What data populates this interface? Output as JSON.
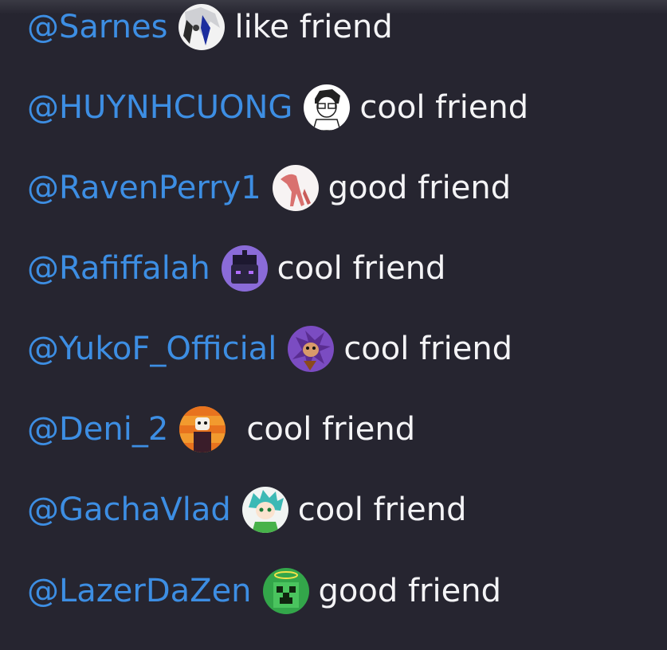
{
  "friends": [
    {
      "mention": "@Sarnes",
      "avatar_icon": "anime-avatar-white-hair-icon",
      "label": "like friend"
    },
    {
      "mention": "@HUYNHCUONG",
      "avatar_icon": "sketch-boy-avatar-icon",
      "label": "cool friend"
    },
    {
      "mention": "@RavenPerry1",
      "avatar_icon": "red-creature-avatar-icon",
      "label": "good friend"
    },
    {
      "mention": "@Rafiffalah",
      "avatar_icon": "robot-avatar-icon",
      "label": "cool friend"
    },
    {
      "mention": "@YukoF_Official",
      "avatar_icon": "purple-hedgehog-avatar-icon",
      "label": "cool friend"
    },
    {
      "mention": "@Deni_2",
      "avatar_icon": "cartoon-character-avatar-icon",
      "label": "cool friend"
    },
    {
      "mention": "@GachaVlad",
      "avatar_icon": "gacha-character-avatar-icon",
      "label": "cool friend"
    },
    {
      "mention": "@LazerDaZen",
      "avatar_icon": "creeper-avatar-icon",
      "label": "good friend"
    }
  ],
  "colors": {
    "background": "#262530",
    "mention": "#3d8ee3",
    "text": "#f4f4f6"
  }
}
